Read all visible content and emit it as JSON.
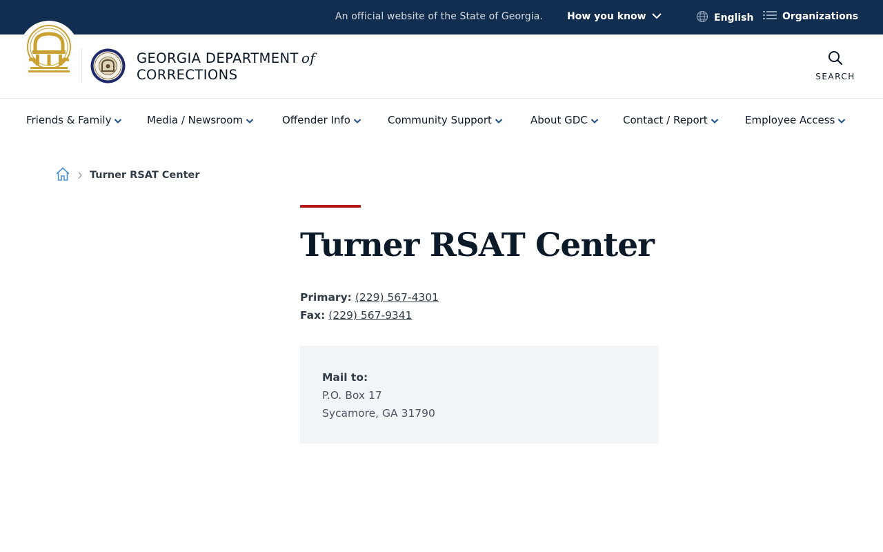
{
  "topbar": {
    "official_text": "An official website of the State of Georgia.",
    "how_you_know": "How you know",
    "language": "English",
    "organizations": "Organizations"
  },
  "header": {
    "brand_line1": "GEORGIA DEPARTMENT",
    "brand_of": "of",
    "brand_line2": "CORRECTIONS",
    "search_label": "SEARCH"
  },
  "nav": {
    "items": [
      {
        "label": "Friends & Family"
      },
      {
        "label": "Media / Newsroom"
      },
      {
        "label": "Offender Info"
      },
      {
        "label": "Community Support"
      },
      {
        "label": "About GDC"
      },
      {
        "label": "Contact / Report"
      },
      {
        "label": "Employee Access"
      }
    ]
  },
  "breadcrumb": {
    "current": "Turner RSAT Center"
  },
  "main": {
    "title": "Turner RSAT Center",
    "primary_label": "Primary:",
    "primary_phone": "(229) 567-4301",
    "fax_label": "Fax:",
    "fax_phone": "(229) 567-9341",
    "mail_label": "Mail to:",
    "mail_line1": "P.O. Box 17",
    "mail_line2": "Sycamore, GA 31790"
  },
  "colors": {
    "topbar_bg": "#112e51",
    "accent_red": "#b31a1a",
    "seal_gold": "#c9a233",
    "nav_chevron": "#1a4e8a"
  },
  "icons": [
    "chevron-down-icon",
    "globe-icon",
    "list-icon",
    "search-icon",
    "home-icon",
    "chevron-right-icon"
  ]
}
